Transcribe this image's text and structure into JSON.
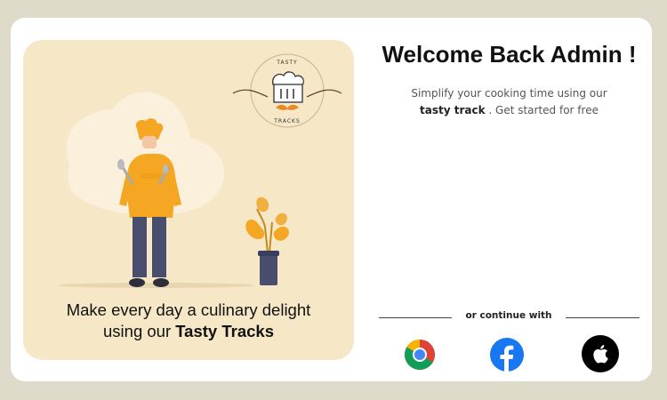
{
  "promo": {
    "tagline_line1": "Make every day a culinary delight",
    "tagline_line2_prefix": "using our ",
    "tagline_brand": "Tasty Tracks",
    "logo_top_text": "TASTY",
    "logo_bottom_text": "TRACKS"
  },
  "login": {
    "title": "Welcome Back Admin !",
    "subtitle_line1": "Simplify your cooking time using our",
    "subtitle_brand": "tasty track",
    "subtitle_suffix": " . Get started for free",
    "continue_label": "or continue with"
  },
  "social": [
    {
      "name": "Chrome",
      "icon": "chrome-icon"
    },
    {
      "name": "Facebook",
      "icon": "facebook-icon"
    },
    {
      "name": "Apple",
      "icon": "apple-icon"
    }
  ],
  "colors": {
    "page_background": "#dedbcb",
    "panel_background": "#f6e7c6",
    "chef_orange": "#f5a623",
    "chef_pants": "#4a4e6e",
    "facebook_blue": "#1877f2"
  }
}
